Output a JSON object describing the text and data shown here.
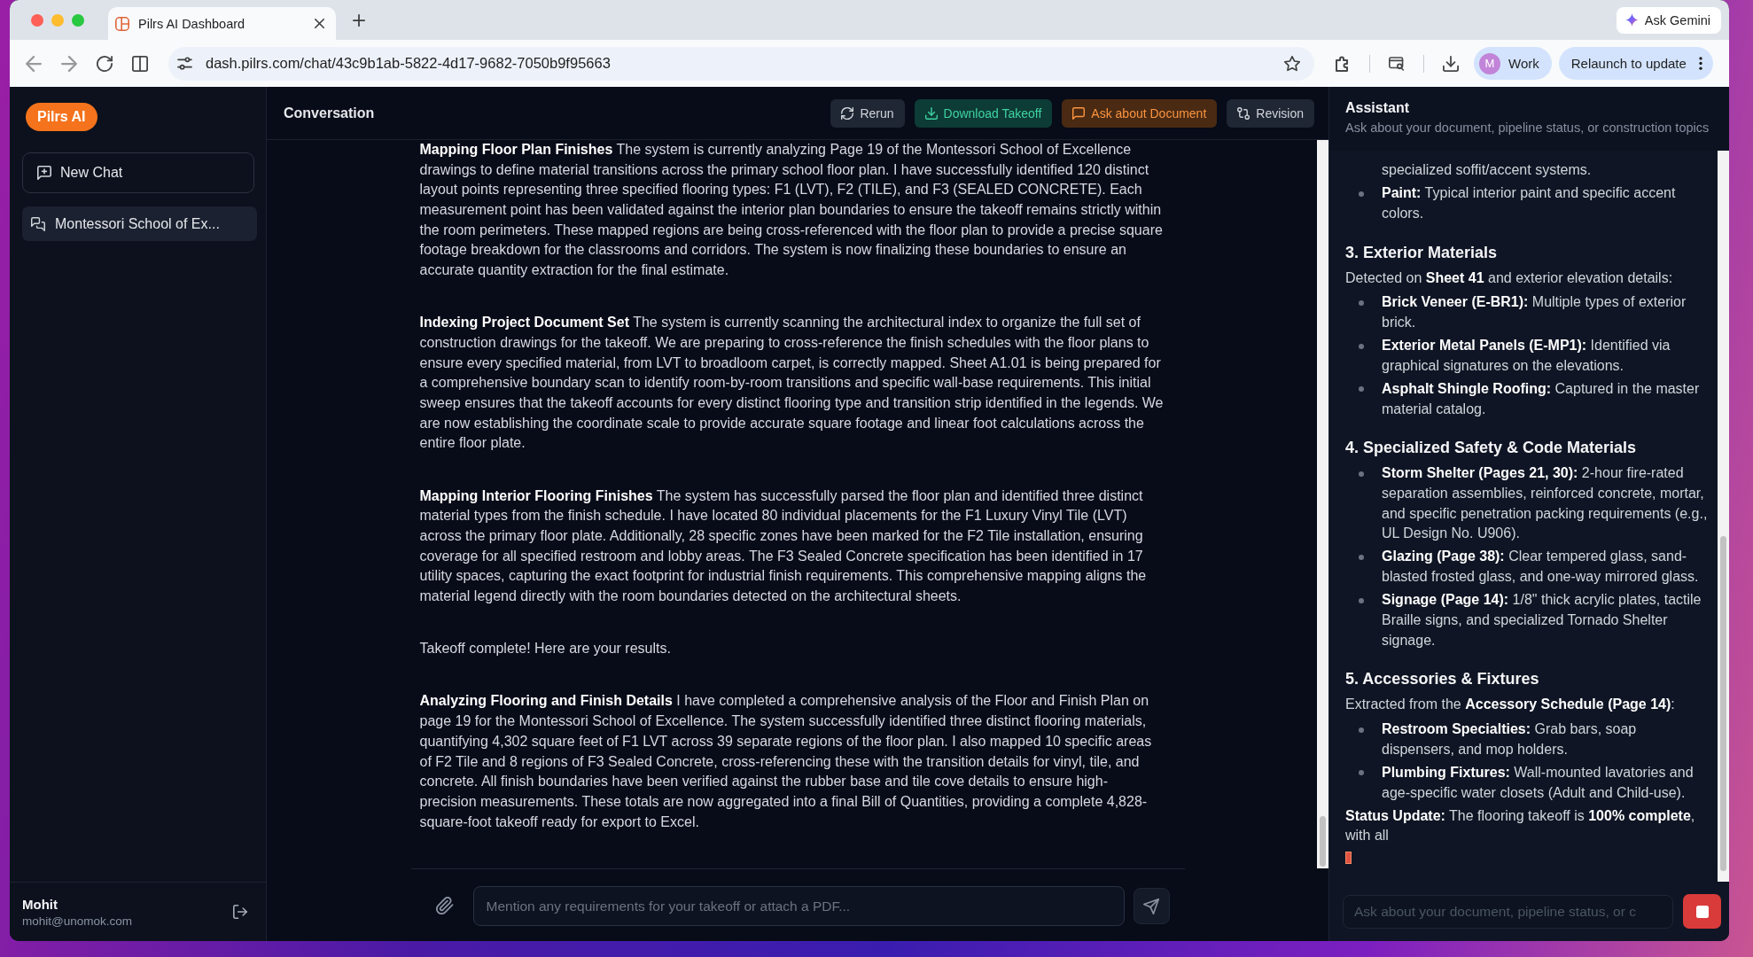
{
  "browser": {
    "tab_title": "Pilrs AI Dashboard",
    "ask_gemini": "Ask Gemini",
    "url": "dash.pilrs.com/chat/43c9b1ab-5822-4d17-9682-7050b9f95663",
    "profile": {
      "initial": "M",
      "label": "Work"
    },
    "relaunch": "Relaunch to update"
  },
  "sidebar": {
    "logo": "Pilrs AI",
    "new_chat": "New Chat",
    "chats": [
      {
        "title": "Montessori School of Ex...",
        "selected": true
      }
    ],
    "user": {
      "name": "Mohit",
      "email": "mohit@unomok.com"
    }
  },
  "conversation": {
    "title": "Conversation",
    "actions": [
      {
        "kind": "rerun",
        "label": "Rerun"
      },
      {
        "kind": "download",
        "label": "Download Takeoff"
      },
      {
        "kind": "ask",
        "label": "Ask about Document"
      },
      {
        "kind": "revision",
        "label": "Revision"
      }
    ],
    "messages": [
      {
        "text": "**Mapping Floor Plan Finishes** The system is currently analyzing Page 19 of the Montessori School of Excellence drawings to define material transitions across the primary school floor plan. I have successfully identified 120 distinct layout points representing three specified flooring types: F1 (LVT), F2 (TILE), and F3 (SEALED CONCRETE). Each measurement point has been validated against the interior plan boundaries to ensure the takeoff remains strictly within the room perimeters. These mapped regions are being cross-referenced with the floor plan to provide a precise square footage breakdown for the classrooms and corridors. The system is now finalizing these boundaries to ensure an accurate quantity extraction for the final estimate."
      },
      {
        "text": "**Indexing Project Document Set** The system is currently scanning the architectural index to organize the full set of construction drawings for the takeoff. We are preparing to cross-reference the finish schedules with the floor plans to ensure every specified material, from LVT to broadloom carpet, is correctly mapped. Sheet A1.01 is being prepared for a comprehensive boundary scan to identify room-by-room transitions and specific wall-base requirements. This initial sweep ensures that the takeoff accounts for every distinct flooring type and transition strip identified in the legends. We are now establishing the coordinate scale to provide accurate square footage and linear foot calculations across the entire floor plate."
      },
      {
        "text": "**Mapping Interior Flooring Finishes** The system has successfully parsed the floor plan and identified three distinct material types from the finish schedule. I have located 80 individual placements for the F1 Luxury Vinyl Tile (LVT) across the primary floor plate. Additionally, 28 specific zones have been marked for the F2 Tile installation, ensuring coverage for all specified restroom and lobby areas. The F3 Sealed Concrete specification has been identified in 17 utility spaces, capturing the exact footprint for industrial finish requirements. This comprehensive mapping aligns the material legend directly with the room boundaries detected on the architectural sheets."
      },
      {
        "text": "Takeoff complete! Here are your results."
      },
      {
        "text": "**Analyzing Flooring and Finish Details** I have completed a comprehensive analysis of the Floor and Finish Plan on page 19 for the Montessori School of Excellence. The system successfully identified three distinct flooring materials, quantifying 4,302 square feet of F1 LVT across 39 separate regions of the floor plan. I also mapped 10 specific areas of F2 Tile and 8 regions of F3 Sealed Concrete, cross-referencing these with the transition details for vinyl, tile, and concrete. All finish boundaries have been verified against the rubber base and tile cove details to ensure high-precision measurements. These totals are now aggregated into a final Bill of Quantities, providing a complete 4,828-square-foot takeoff ready for export to Excel."
      }
    ],
    "input": {
      "placeholder": "Mention any requirements for your takeoff or attach a PDF..."
    }
  },
  "assistant": {
    "title": "Assistant",
    "subtitle": "Ask about your document, pipeline status, or construction topics",
    "blocks": [
      {
        "kind": "continuation",
        "text": "specialized soffit/accent systems."
      },
      {
        "kind": "bullet",
        "text": "**Paint:** Typical interior paint and specific accent colors."
      },
      {
        "kind": "heading",
        "text": "3. Exterior Materials"
      },
      {
        "kind": "paragraph",
        "text": "Detected on **Sheet 41** and exterior elevation details:"
      },
      {
        "kind": "bullet",
        "text": "**Brick Veneer (E-BR1):** Multiple types of exterior brick."
      },
      {
        "kind": "bullet",
        "text": "**Exterior Metal Panels (E-MP1):** Identified via graphical signatures on the elevations."
      },
      {
        "kind": "bullet",
        "text": "**Asphalt Shingle Roofing:** Captured in the master material catalog."
      },
      {
        "kind": "heading",
        "text": "4. Specialized Safety & Code Materials"
      },
      {
        "kind": "bullet",
        "text": "**Storm Shelter (Pages 21, 30):** 2-hour fire-rated separation assemblies, reinforced concrete, mortar, and specific penetration packing requirements (e.g., UL Design No. U906)."
      },
      {
        "kind": "bullet",
        "text": "**Glazing (Page 38):** Clear tempered glass, sand-blasted frosted glass, and one-way mirrored glass."
      },
      {
        "kind": "bullet",
        "text": "**Signage (Page 14):** 1/8\" thick acrylic plates, tactile Braille signs, and specialized Tornado Shelter signage."
      },
      {
        "kind": "heading",
        "text": "5. Accessories & Fixtures"
      },
      {
        "kind": "paragraph",
        "text": "Extracted from the **Accessory Schedule (Page 14)**:"
      },
      {
        "kind": "bullet",
        "text": "**Restroom Specialties:** Grab bars, soap dispensers, and mop holders."
      },
      {
        "kind": "bullet",
        "text": "**Plumbing Fixtures:** Wall-mounted lavatories and age-specific water closets (Adult and Child-use)."
      },
      {
        "kind": "paragraph",
        "text": "**Status Update:** The flooring takeoff is **100% complete**, with all"
      }
    ],
    "streaming": true,
    "input": {
      "placeholder": "Ask about your document, pipeline status, or c"
    }
  }
}
